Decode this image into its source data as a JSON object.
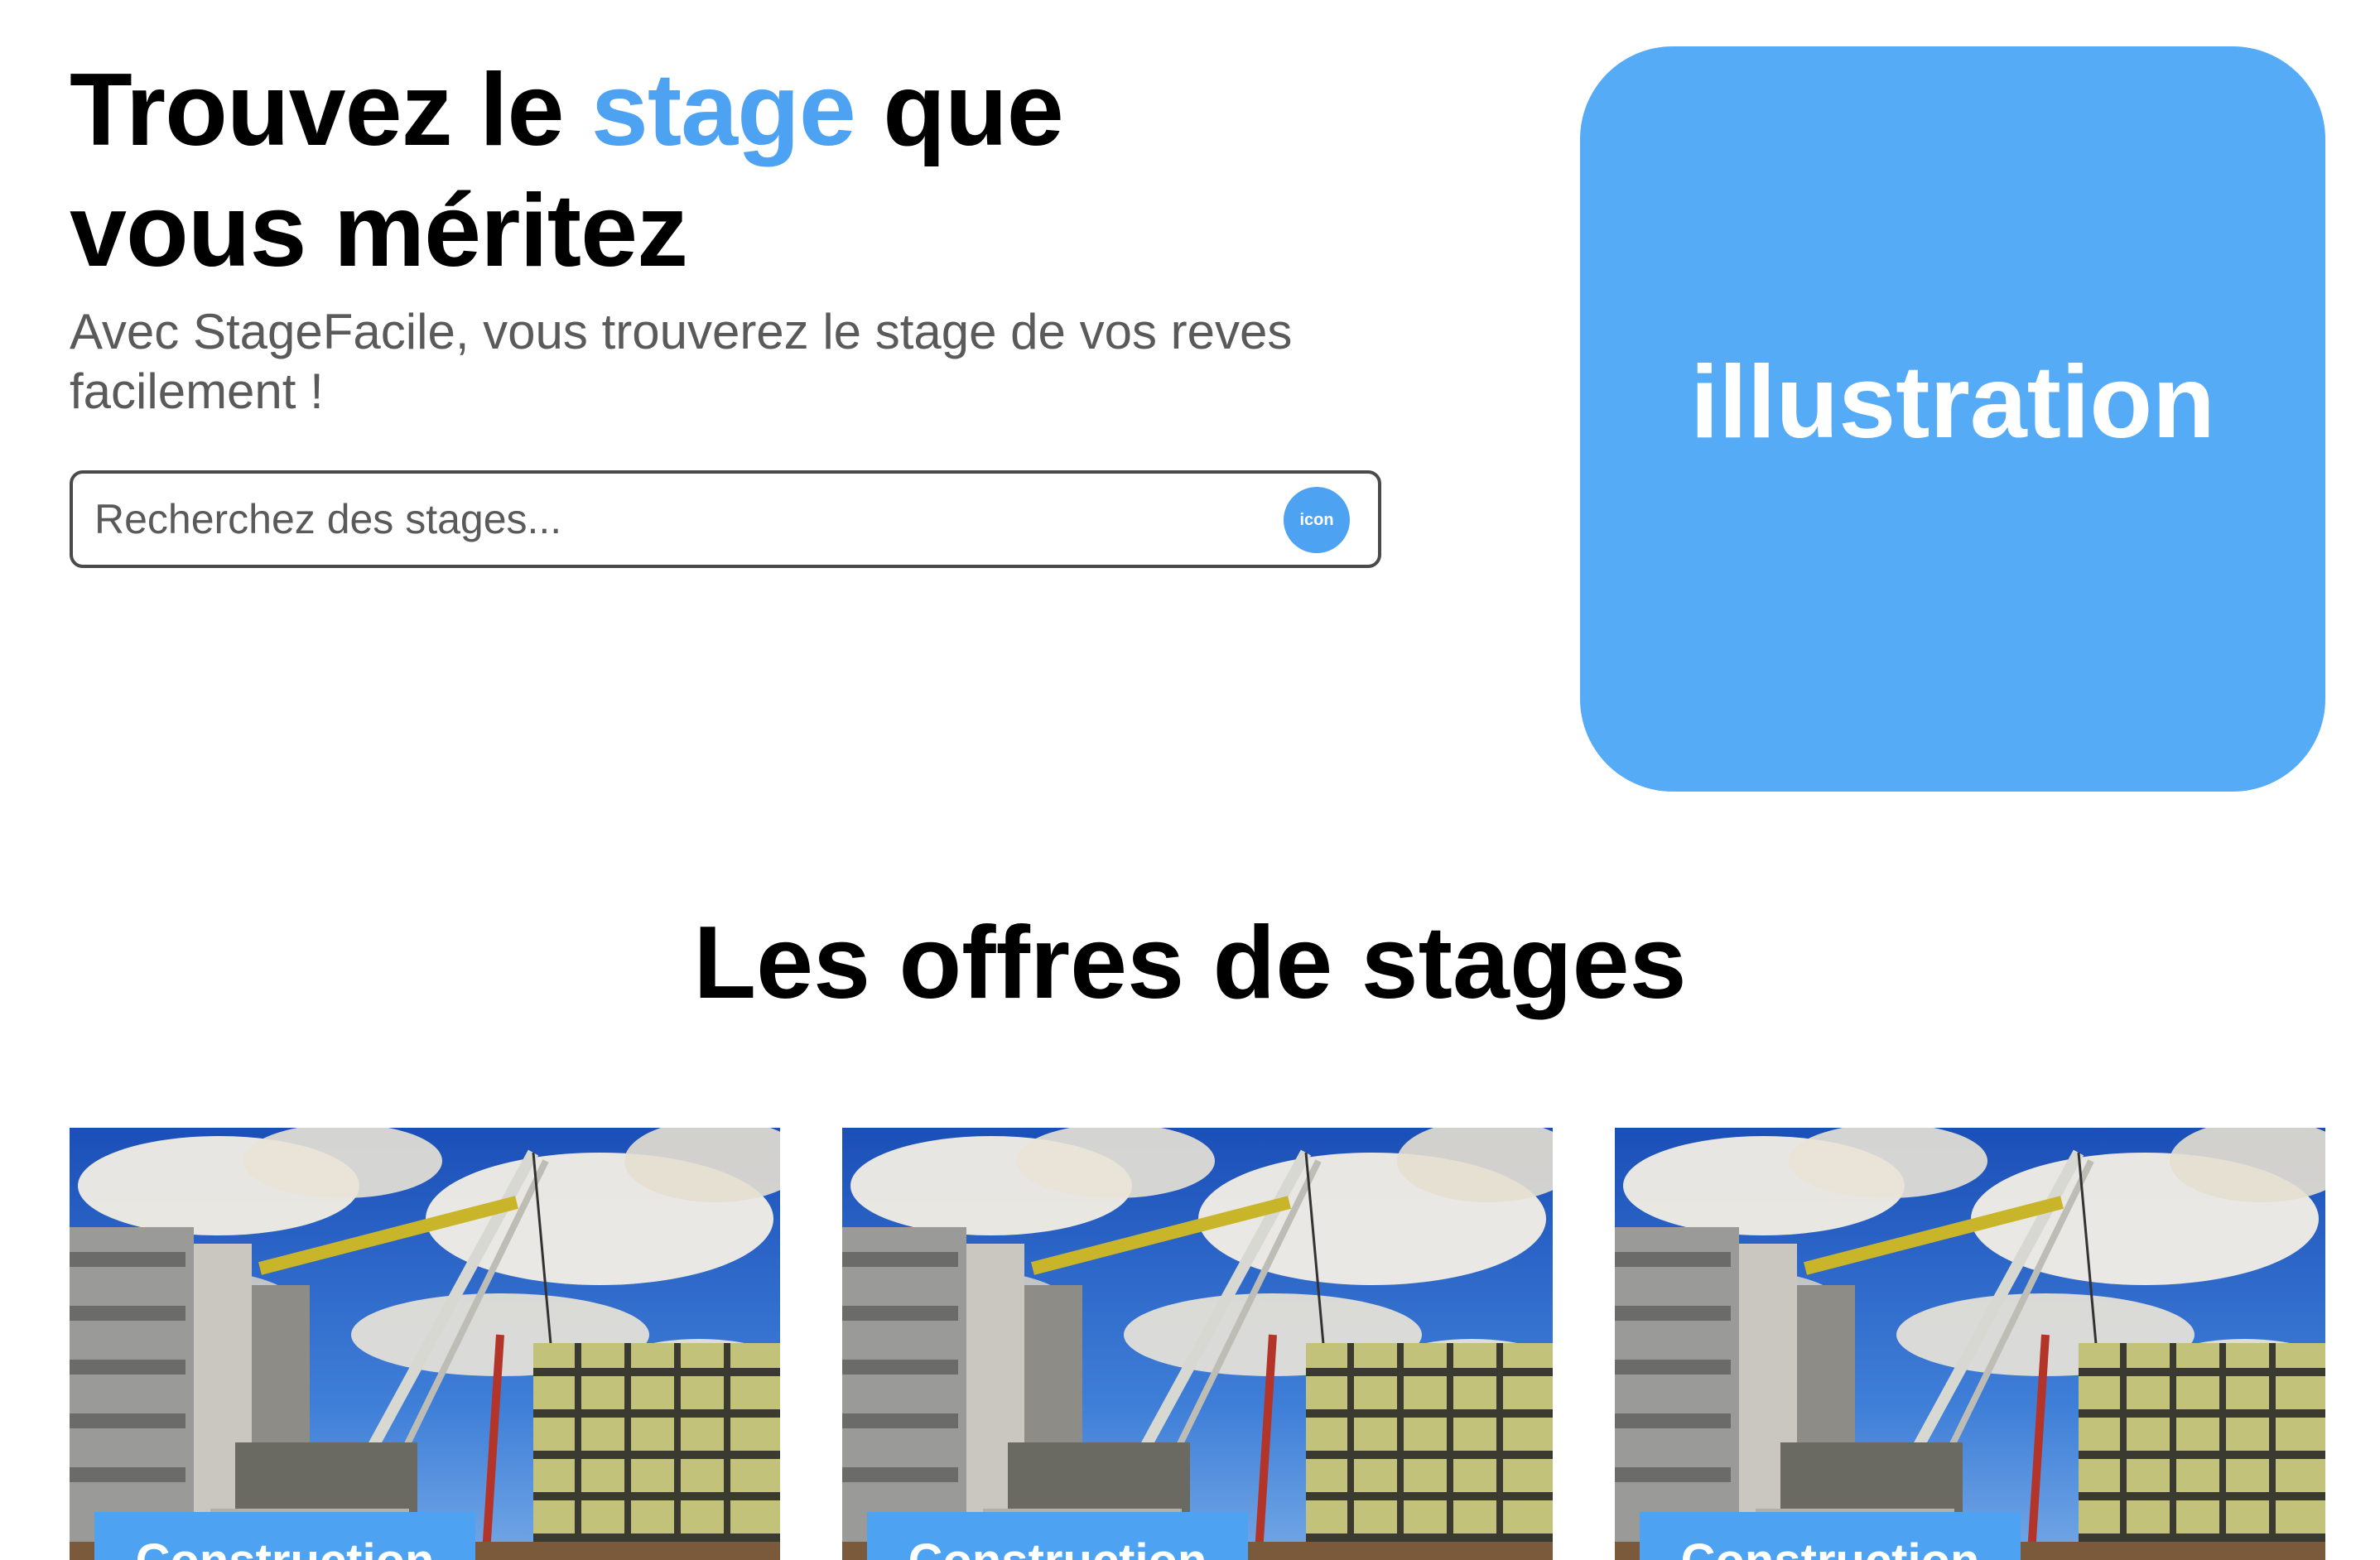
{
  "hero": {
    "title_part1": "Trouvez le ",
    "title_accent": "stage",
    "title_part2": " que vous méritez",
    "subtitle": "Avec StageFacile, vous trouverez le stage de vos reves facilement !"
  },
  "search": {
    "placeholder": "Recherchez des stages...",
    "value": "",
    "button_label": "icon",
    "button_icon": "search-icon"
  },
  "illustration": {
    "label": "illustration"
  },
  "offers": {
    "title": "Les offres de stages",
    "cards": [
      {
        "category": "Construction",
        "image": "construction-site-photo"
      },
      {
        "category": "Construction",
        "image": "construction-site-photo"
      },
      {
        "category": "Construction",
        "image": "construction-site-photo"
      }
    ]
  },
  "colors": {
    "accent": "#4da3f1",
    "illustration_bg": "#55abf6",
    "text_dark": "#000000",
    "text_muted": "#5a5a5a"
  }
}
